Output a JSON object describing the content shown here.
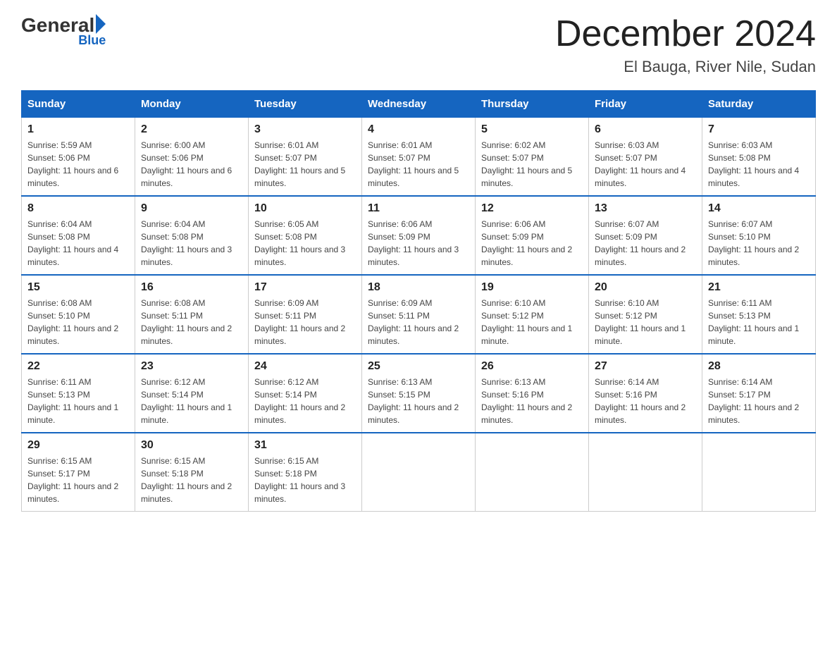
{
  "logo": {
    "general": "General",
    "blue": "Blue"
  },
  "header": {
    "month_year": "December 2024",
    "location": "El Bauga, River Nile, Sudan"
  },
  "days_of_week": [
    "Sunday",
    "Monday",
    "Tuesday",
    "Wednesday",
    "Thursday",
    "Friday",
    "Saturday"
  ],
  "weeks": [
    [
      {
        "day": "1",
        "sunrise": "Sunrise: 5:59 AM",
        "sunset": "Sunset: 5:06 PM",
        "daylight": "Daylight: 11 hours and 6 minutes."
      },
      {
        "day": "2",
        "sunrise": "Sunrise: 6:00 AM",
        "sunset": "Sunset: 5:06 PM",
        "daylight": "Daylight: 11 hours and 6 minutes."
      },
      {
        "day": "3",
        "sunrise": "Sunrise: 6:01 AM",
        "sunset": "Sunset: 5:07 PM",
        "daylight": "Daylight: 11 hours and 5 minutes."
      },
      {
        "day": "4",
        "sunrise": "Sunrise: 6:01 AM",
        "sunset": "Sunset: 5:07 PM",
        "daylight": "Daylight: 11 hours and 5 minutes."
      },
      {
        "day": "5",
        "sunrise": "Sunrise: 6:02 AM",
        "sunset": "Sunset: 5:07 PM",
        "daylight": "Daylight: 11 hours and 5 minutes."
      },
      {
        "day": "6",
        "sunrise": "Sunrise: 6:03 AM",
        "sunset": "Sunset: 5:07 PM",
        "daylight": "Daylight: 11 hours and 4 minutes."
      },
      {
        "day": "7",
        "sunrise": "Sunrise: 6:03 AM",
        "sunset": "Sunset: 5:08 PM",
        "daylight": "Daylight: 11 hours and 4 minutes."
      }
    ],
    [
      {
        "day": "8",
        "sunrise": "Sunrise: 6:04 AM",
        "sunset": "Sunset: 5:08 PM",
        "daylight": "Daylight: 11 hours and 4 minutes."
      },
      {
        "day": "9",
        "sunrise": "Sunrise: 6:04 AM",
        "sunset": "Sunset: 5:08 PM",
        "daylight": "Daylight: 11 hours and 3 minutes."
      },
      {
        "day": "10",
        "sunrise": "Sunrise: 6:05 AM",
        "sunset": "Sunset: 5:08 PM",
        "daylight": "Daylight: 11 hours and 3 minutes."
      },
      {
        "day": "11",
        "sunrise": "Sunrise: 6:06 AM",
        "sunset": "Sunset: 5:09 PM",
        "daylight": "Daylight: 11 hours and 3 minutes."
      },
      {
        "day": "12",
        "sunrise": "Sunrise: 6:06 AM",
        "sunset": "Sunset: 5:09 PM",
        "daylight": "Daylight: 11 hours and 2 minutes."
      },
      {
        "day": "13",
        "sunrise": "Sunrise: 6:07 AM",
        "sunset": "Sunset: 5:09 PM",
        "daylight": "Daylight: 11 hours and 2 minutes."
      },
      {
        "day": "14",
        "sunrise": "Sunrise: 6:07 AM",
        "sunset": "Sunset: 5:10 PM",
        "daylight": "Daylight: 11 hours and 2 minutes."
      }
    ],
    [
      {
        "day": "15",
        "sunrise": "Sunrise: 6:08 AM",
        "sunset": "Sunset: 5:10 PM",
        "daylight": "Daylight: 11 hours and 2 minutes."
      },
      {
        "day": "16",
        "sunrise": "Sunrise: 6:08 AM",
        "sunset": "Sunset: 5:11 PM",
        "daylight": "Daylight: 11 hours and 2 minutes."
      },
      {
        "day": "17",
        "sunrise": "Sunrise: 6:09 AM",
        "sunset": "Sunset: 5:11 PM",
        "daylight": "Daylight: 11 hours and 2 minutes."
      },
      {
        "day": "18",
        "sunrise": "Sunrise: 6:09 AM",
        "sunset": "Sunset: 5:11 PM",
        "daylight": "Daylight: 11 hours and 2 minutes."
      },
      {
        "day": "19",
        "sunrise": "Sunrise: 6:10 AM",
        "sunset": "Sunset: 5:12 PM",
        "daylight": "Daylight: 11 hours and 1 minute."
      },
      {
        "day": "20",
        "sunrise": "Sunrise: 6:10 AM",
        "sunset": "Sunset: 5:12 PM",
        "daylight": "Daylight: 11 hours and 1 minute."
      },
      {
        "day": "21",
        "sunrise": "Sunrise: 6:11 AM",
        "sunset": "Sunset: 5:13 PM",
        "daylight": "Daylight: 11 hours and 1 minute."
      }
    ],
    [
      {
        "day": "22",
        "sunrise": "Sunrise: 6:11 AM",
        "sunset": "Sunset: 5:13 PM",
        "daylight": "Daylight: 11 hours and 1 minute."
      },
      {
        "day": "23",
        "sunrise": "Sunrise: 6:12 AM",
        "sunset": "Sunset: 5:14 PM",
        "daylight": "Daylight: 11 hours and 1 minute."
      },
      {
        "day": "24",
        "sunrise": "Sunrise: 6:12 AM",
        "sunset": "Sunset: 5:14 PM",
        "daylight": "Daylight: 11 hours and 2 minutes."
      },
      {
        "day": "25",
        "sunrise": "Sunrise: 6:13 AM",
        "sunset": "Sunset: 5:15 PM",
        "daylight": "Daylight: 11 hours and 2 minutes."
      },
      {
        "day": "26",
        "sunrise": "Sunrise: 6:13 AM",
        "sunset": "Sunset: 5:16 PM",
        "daylight": "Daylight: 11 hours and 2 minutes."
      },
      {
        "day": "27",
        "sunrise": "Sunrise: 6:14 AM",
        "sunset": "Sunset: 5:16 PM",
        "daylight": "Daylight: 11 hours and 2 minutes."
      },
      {
        "day": "28",
        "sunrise": "Sunrise: 6:14 AM",
        "sunset": "Sunset: 5:17 PM",
        "daylight": "Daylight: 11 hours and 2 minutes."
      }
    ],
    [
      {
        "day": "29",
        "sunrise": "Sunrise: 6:15 AM",
        "sunset": "Sunset: 5:17 PM",
        "daylight": "Daylight: 11 hours and 2 minutes."
      },
      {
        "day": "30",
        "sunrise": "Sunrise: 6:15 AM",
        "sunset": "Sunset: 5:18 PM",
        "daylight": "Daylight: 11 hours and 2 minutes."
      },
      {
        "day": "31",
        "sunrise": "Sunrise: 6:15 AM",
        "sunset": "Sunset: 5:18 PM",
        "daylight": "Daylight: 11 hours and 3 minutes."
      },
      {
        "day": "",
        "sunrise": "",
        "sunset": "",
        "daylight": ""
      },
      {
        "day": "",
        "sunrise": "",
        "sunset": "",
        "daylight": ""
      },
      {
        "day": "",
        "sunrise": "",
        "sunset": "",
        "daylight": ""
      },
      {
        "day": "",
        "sunrise": "",
        "sunset": "",
        "daylight": ""
      }
    ]
  ]
}
